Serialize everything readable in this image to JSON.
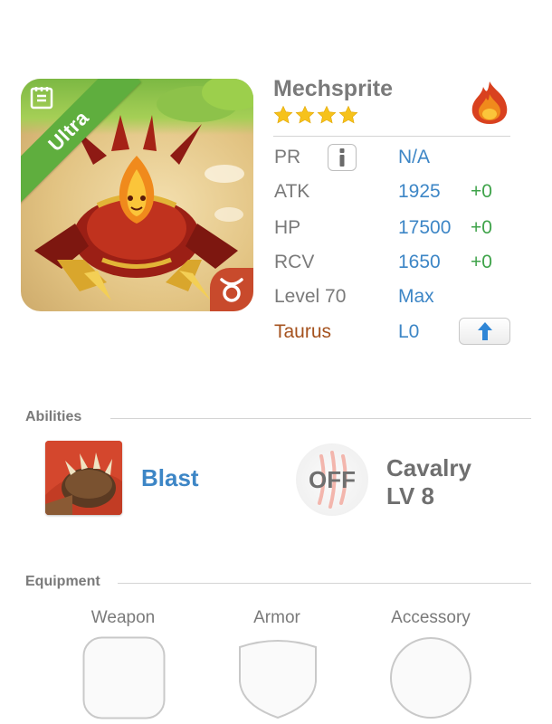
{
  "monster": {
    "name": "Mechsprite",
    "rarity": "Ultra",
    "stars": 4,
    "element": "fire",
    "zodiac_icon": "taurus-icon",
    "stats": {
      "pr_label": "PR",
      "pr_value": "N/A",
      "atk_label": "ATK",
      "atk_value": "1925",
      "atk_bonus": "+0",
      "hp_label": "HP",
      "hp_value": "17500",
      "hp_bonus": "+0",
      "rcv_label": "RCV",
      "rcv_value": "1650",
      "rcv_bonus": "+0",
      "level_label": "Level 70",
      "level_value": "Max",
      "zodiac_label": "Taurus",
      "zodiac_value": "L0"
    }
  },
  "abilities": {
    "title": "Abilities",
    "active": {
      "name": "Blast",
      "icon": "claw-fist-icon"
    },
    "passive": {
      "state": "OFF",
      "name_line1": "Cavalry",
      "name_line2": "LV 8",
      "icon": "claw-scratch-icon"
    }
  },
  "equipment": {
    "title": "Equipment",
    "slots": [
      {
        "label": "Weapon",
        "icon": "weapon-slot-icon"
      },
      {
        "label": "Armor",
        "icon": "armor-slot-icon"
      },
      {
        "label": "Accessory",
        "icon": "accessory-slot-icon"
      }
    ]
  },
  "colors": {
    "stat_value": "#3d86c6",
    "stat_bonus": "#3fa34a",
    "zodiac_label": "#a5521e",
    "ribbon": "#5fae3e"
  }
}
